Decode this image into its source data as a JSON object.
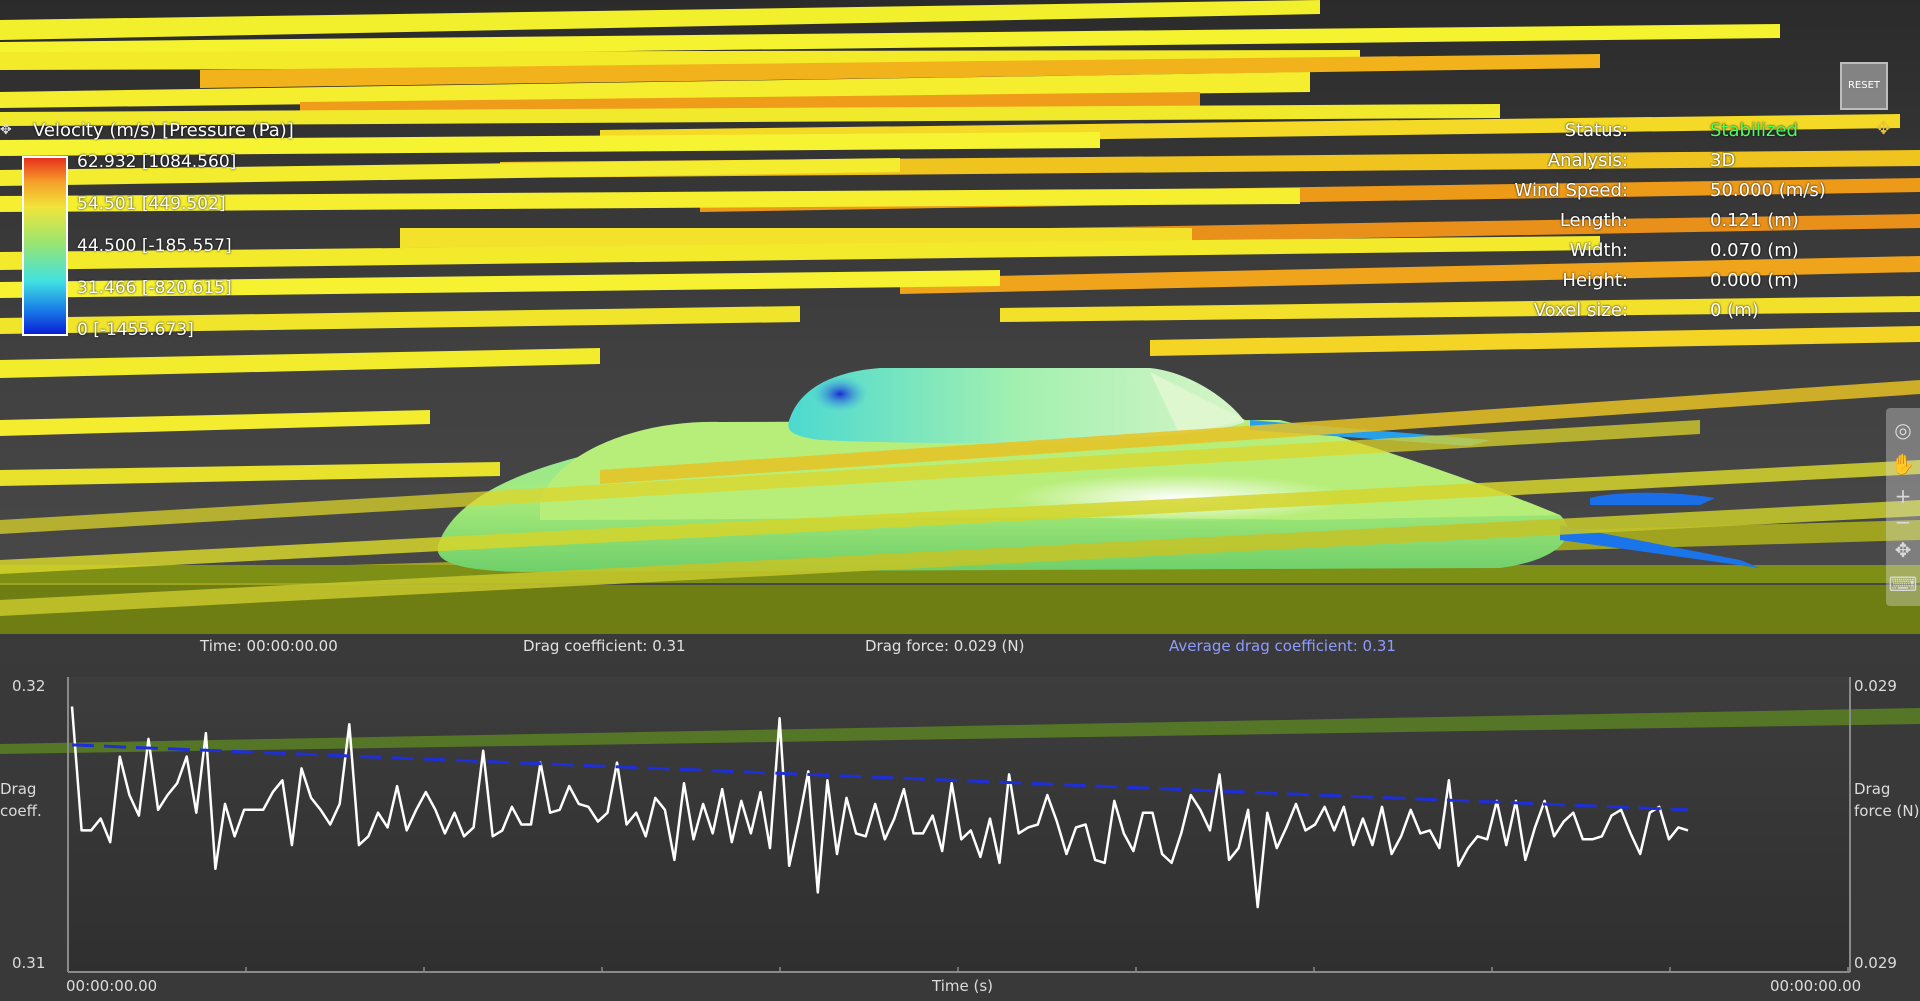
{
  "legend": {
    "title": "Velocity (m/s) [Pressure (Pa)]",
    "labels": [
      "62.932 [1084.560]",
      "54.501 [449.502]",
      "44.500 [-185.557]",
      "31.466 [-820.615]",
      "0 [-1455.673]"
    ],
    "colors": [
      "#e8301c",
      "#f5a22a",
      "#f1e53a",
      "#9be570",
      "#40e1e0",
      "#1a7fe8",
      "#0a1fd6"
    ]
  },
  "info": {
    "rows": [
      {
        "label": "Status:",
        "value": "Stabilized"
      },
      {
        "label": "Analysis:",
        "value": "3D"
      },
      {
        "label": "Wind Speed:",
        "value": "50.000 (m/s)"
      },
      {
        "label": "Length:",
        "value": "0.121 (m)"
      },
      {
        "label": "Width:",
        "value": "0.070 (m)"
      },
      {
        "label": "Height:",
        "value": "0.000 (m)"
      },
      {
        "label": "Voxel size:",
        "value": "0 (m)"
      }
    ]
  },
  "reset_label": "RESET",
  "toolbar": {
    "icons": [
      "camera-icon",
      "hand-icon",
      "zoom-in-icon",
      "zoom-out-icon",
      "rotate-icon",
      "keyboard-icon"
    ],
    "glyphs": [
      "◎",
      "✋",
      "+",
      "−",
      "✥",
      "⌨"
    ]
  },
  "status": {
    "time": "Time: 00:00:00.00",
    "drag_coefficient": "Drag coefficient: 0.31",
    "drag_force": "Drag force: 0.029 (N)",
    "avg_drag": "Average drag coefficient: 0.31"
  },
  "chart_data": {
    "type": "line",
    "xlabel": "Time (s)",
    "x_start_label": "00:00:00.00",
    "x_end_label": "00:00:00.00",
    "y_left": {
      "label_line1": "Drag",
      "label_line2": "coeff.",
      "top": "0.32",
      "bottom": "0.31"
    },
    "y_right": {
      "label_line1": "Drag",
      "label_line2": "force (N)",
      "top": "0.029",
      "bottom": "0.029"
    },
    "ylim": [
      0.31,
      0.32
    ],
    "series": [
      {
        "color": "#ffffff",
        "values": [
          0.319,
          0.3148,
          0.3148,
          0.3152,
          0.3144,
          0.3173,
          0.316,
          0.3153,
          0.3179,
          0.3155,
          0.316,
          0.3164,
          0.3173,
          0.3154,
          0.3181,
          0.3135,
          0.3157,
          0.3146,
          0.3155,
          0.3155,
          0.3155,
          0.3161,
          0.3165,
          0.3143,
          0.3169,
          0.3159,
          0.3155,
          0.315,
          0.3157,
          0.3184,
          0.3143,
          0.3146,
          0.3154,
          0.3149,
          0.3163,
          0.3148,
          0.3155,
          0.3161,
          0.3155,
          0.3147,
          0.3154,
          0.3146,
          0.3149,
          0.3175,
          0.3146,
          0.3148,
          0.3156,
          0.315,
          0.315,
          0.3171,
          0.3154,
          0.3155,
          0.3163,
          0.3157,
          0.3156,
          0.3151,
          0.3154,
          0.3171,
          0.315,
          0.3154,
          0.3146,
          0.3159,
          0.3155,
          0.3138,
          0.3164,
          0.3145,
          0.3157,
          0.3147,
          0.3162,
          0.3144,
          0.3158,
          0.3147,
          0.3161,
          0.3142,
          0.3186,
          0.3136,
          0.3151,
          0.3168,
          0.3127,
          0.3165,
          0.314,
          0.3159,
          0.3147,
          0.3146,
          0.3157,
          0.3145,
          0.3152,
          0.3162,
          0.3147,
          0.3147,
          0.3153,
          0.3141,
          0.3164,
          0.3145,
          0.3148,
          0.3139,
          0.3152,
          0.3137,
          0.3167,
          0.3147,
          0.3149,
          0.315,
          0.316,
          0.3151,
          0.314,
          0.3149,
          0.315,
          0.3138,
          0.3137,
          0.3158,
          0.3147,
          0.3141,
          0.3154,
          0.3154,
          0.314,
          0.3137,
          0.3147,
          0.316,
          0.3155,
          0.3148,
          0.3167,
          0.3138,
          0.3142,
          0.3155,
          0.3122,
          0.3154,
          0.3142,
          0.3149,
          0.3157,
          0.3148,
          0.315,
          0.3156,
          0.3148,
          0.3156,
          0.3143,
          0.3152,
          0.3143,
          0.3156,
          0.314,
          0.3146,
          0.3155,
          0.3147,
          0.3148,
          0.3142,
          0.3165,
          0.3136,
          0.3142,
          0.3146,
          0.3145,
          0.3158,
          0.3143,
          0.3158,
          0.3138,
          0.3149,
          0.3158,
          0.3146,
          0.3151,
          0.3154,
          0.3145,
          0.3145,
          0.3146,
          0.3153,
          0.3155,
          0.3147,
          0.314,
          0.3154,
          0.3156,
          0.3145,
          0.3149,
          0.3148
        ]
      },
      {
        "color": "#1e2fd8",
        "dashed": true,
        "values": [
          0.3177,
          0.3155
        ]
      }
    ]
  }
}
